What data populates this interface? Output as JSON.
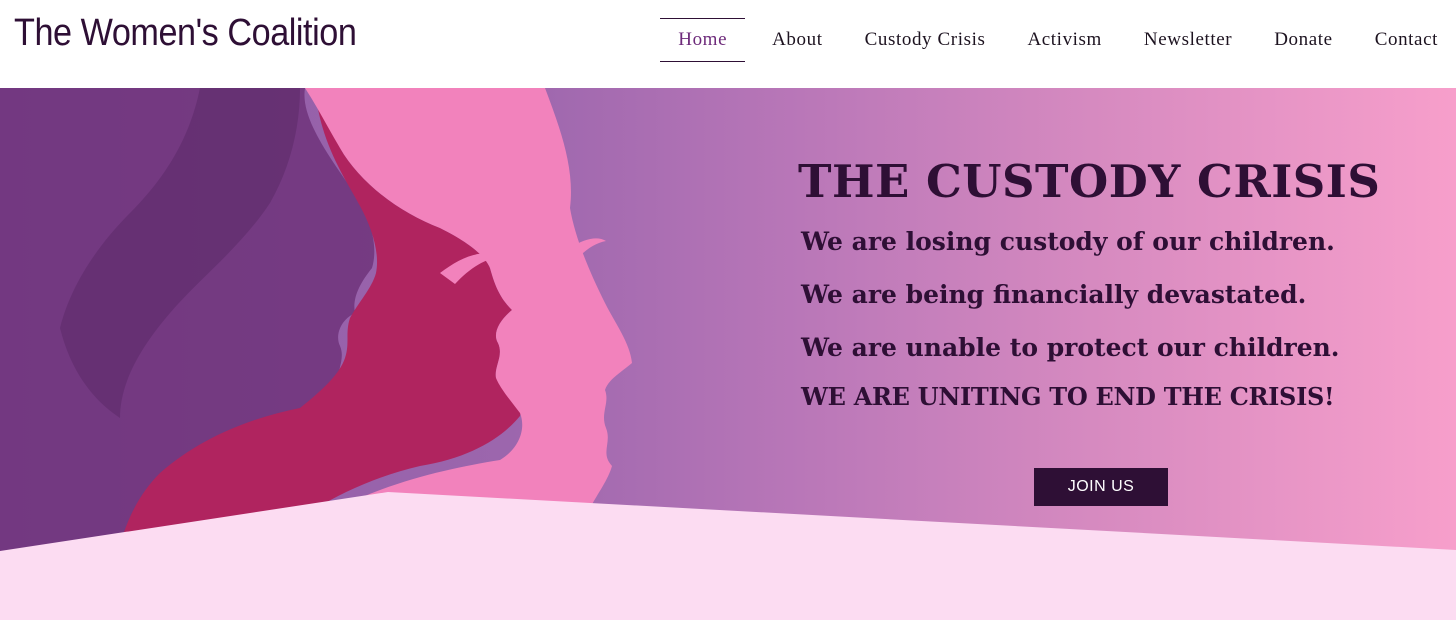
{
  "header": {
    "brand": "The Women's Coalition",
    "nav": [
      {
        "label": "Home",
        "active": true
      },
      {
        "label": "About"
      },
      {
        "label": "Custody Crisis"
      },
      {
        "label": "Activism"
      },
      {
        "label": "Newsletter"
      },
      {
        "label": "Donate"
      },
      {
        "label": "Contact"
      }
    ]
  },
  "hero": {
    "title": "THE CUSTODY CRISIS",
    "lines": [
      "We are losing custody of our children.",
      "We are being financially devastated.",
      "We are unable to protect our children."
    ],
    "call_to_action": "WE ARE UNITING TO END THE CRISIS!",
    "button_label": "JOIN US",
    "illustration": "three-women-profile-silhouettes"
  },
  "colors": {
    "brand_dark": "#2e0f35",
    "nav_active": "#6d2a7a",
    "gradient_start": "#8e5aa6",
    "gradient_end": "#f79fcb",
    "floor": "#fcdcf2"
  }
}
